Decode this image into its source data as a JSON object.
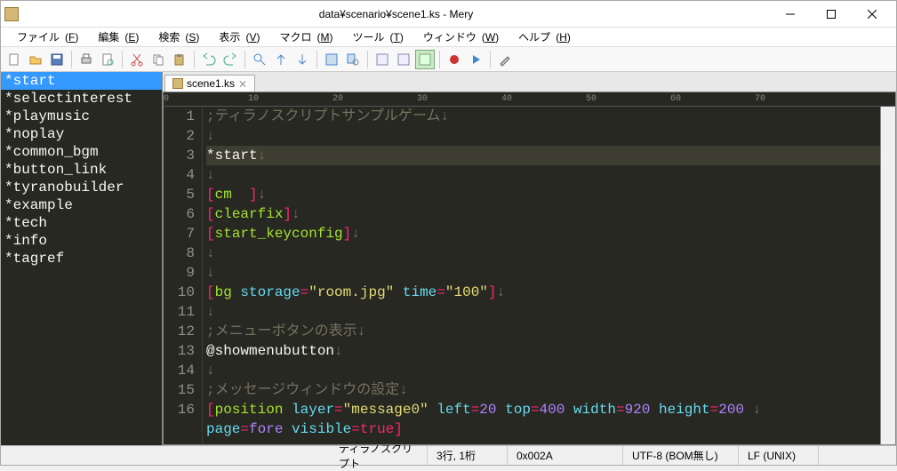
{
  "window": {
    "title": "data¥scenario¥scene1.ks - Mery"
  },
  "menus": {
    "file": {
      "label": "ファイル",
      "key": "F"
    },
    "edit": {
      "label": "編集",
      "key": "E"
    },
    "search": {
      "label": "検索",
      "key": "S"
    },
    "view": {
      "label": "表示",
      "key": "V"
    },
    "macro": {
      "label": "マクロ",
      "key": "M"
    },
    "tool": {
      "label": "ツール",
      "key": "T"
    },
    "window": {
      "label": "ウィンドウ",
      "key": "W"
    },
    "help": {
      "label": "ヘルプ",
      "key": "H"
    }
  },
  "sidebar": {
    "items": [
      "*start",
      "*selectinterest",
      "*playmusic",
      "*noplay",
      "*common_bgm",
      "*button_link",
      "*tyranobuilder",
      "*example",
      "*tech",
      "*info",
      "*tagref"
    ],
    "selected": 0
  },
  "tabs": [
    {
      "label": "scene1.ks"
    }
  ],
  "ruler": {
    "marks": [
      "0",
      "10",
      "20",
      "30",
      "40",
      "50",
      "60",
      "70"
    ]
  },
  "code": {
    "lines": [
      {
        "n": 1,
        "segs": [
          {
            "t": ";ティラノスクリプトサンプルゲーム",
            "c": "c-comment"
          }
        ]
      },
      {
        "n": 2,
        "segs": []
      },
      {
        "n": 3,
        "cur": true,
        "segs": [
          {
            "t": "*start",
            "c": "c-label"
          }
        ]
      },
      {
        "n": 4,
        "segs": []
      },
      {
        "n": 5,
        "segs": [
          {
            "t": "[",
            "c": "c-br"
          },
          {
            "t": "cm",
            "c": "c-tag"
          },
          {
            "t": "  ",
            "c": ""
          },
          {
            "t": "]",
            "c": "c-br"
          }
        ]
      },
      {
        "n": 6,
        "segs": [
          {
            "t": "[",
            "c": "c-br"
          },
          {
            "t": "clearfix",
            "c": "c-tag"
          },
          {
            "t": "]",
            "c": "c-br"
          }
        ]
      },
      {
        "n": 7,
        "segs": [
          {
            "t": "[",
            "c": "c-br"
          },
          {
            "t": "start_keyconfig",
            "c": "c-tag"
          },
          {
            "t": "]",
            "c": "c-br"
          }
        ]
      },
      {
        "n": 8,
        "segs": []
      },
      {
        "n": 9,
        "segs": []
      },
      {
        "n": 10,
        "segs": [
          {
            "t": "[",
            "c": "c-br"
          },
          {
            "t": "bg",
            "c": "c-tag"
          },
          {
            "t": " ",
            "c": ""
          },
          {
            "t": "storage",
            "c": "c-attr"
          },
          {
            "t": "=",
            "c": "c-br"
          },
          {
            "t": "\"room.jpg\"",
            "c": "c-str"
          },
          {
            "t": " ",
            "c": ""
          },
          {
            "t": "time",
            "c": "c-attr"
          },
          {
            "t": "=",
            "c": "c-br"
          },
          {
            "t": "\"100\"",
            "c": "c-str"
          },
          {
            "t": "]",
            "c": "c-br"
          }
        ]
      },
      {
        "n": 11,
        "segs": []
      },
      {
        "n": 12,
        "segs": [
          {
            "t": ";メニューボタンの表示",
            "c": "c-comment"
          }
        ]
      },
      {
        "n": 13,
        "segs": [
          {
            "t": "@showmenubutton",
            "c": "c-cmd"
          }
        ]
      },
      {
        "n": 14,
        "segs": []
      },
      {
        "n": 15,
        "segs": [
          {
            "t": ";メッセージウィンドウの設定",
            "c": "c-comment"
          }
        ]
      },
      {
        "n": 16,
        "segs": [
          {
            "t": "[",
            "c": "c-br"
          },
          {
            "t": "position",
            "c": "c-tag"
          },
          {
            "t": " ",
            "c": ""
          },
          {
            "t": "layer",
            "c": "c-attr"
          },
          {
            "t": "=",
            "c": "c-br"
          },
          {
            "t": "\"message0\"",
            "c": "c-str"
          },
          {
            "t": " ",
            "c": ""
          },
          {
            "t": "left",
            "c": "c-attr"
          },
          {
            "t": "=",
            "c": "c-br"
          },
          {
            "t": "20",
            "c": "c-num"
          },
          {
            "t": " ",
            "c": ""
          },
          {
            "t": "top",
            "c": "c-attr"
          },
          {
            "t": "=",
            "c": "c-br"
          },
          {
            "t": "400",
            "c": "c-num"
          },
          {
            "t": " ",
            "c": ""
          },
          {
            "t": "width",
            "c": "c-attr"
          },
          {
            "t": "=",
            "c": "c-br"
          },
          {
            "t": "920",
            "c": "c-num"
          },
          {
            "t": " ",
            "c": ""
          },
          {
            "t": "height",
            "c": "c-attr"
          },
          {
            "t": "=",
            "c": "c-br"
          },
          {
            "t": "200",
            "c": "c-num"
          },
          {
            "t": " ",
            "c": ""
          }
        ]
      },
      {
        "n": 0,
        "cont": true,
        "segs": [
          {
            "t": "page",
            "c": "c-attr"
          },
          {
            "t": "=",
            "c": "c-br"
          },
          {
            "t": "fore",
            "c": "c-num"
          },
          {
            "t": " ",
            "c": ""
          },
          {
            "t": "visible",
            "c": "c-attr"
          },
          {
            "t": "=",
            "c": "c-br"
          },
          {
            "t": "true",
            "c": "c-bool"
          },
          {
            "t": "]",
            "c": "c-br"
          }
        ]
      }
    ]
  },
  "status": {
    "lang": "ティラノスクリプト",
    "pos": "3行, 1桁",
    "code": "0x002A",
    "enc": "UTF-8 (BOM無し)",
    "eol": "LF (UNIX)"
  },
  "eol_mark": "↓"
}
